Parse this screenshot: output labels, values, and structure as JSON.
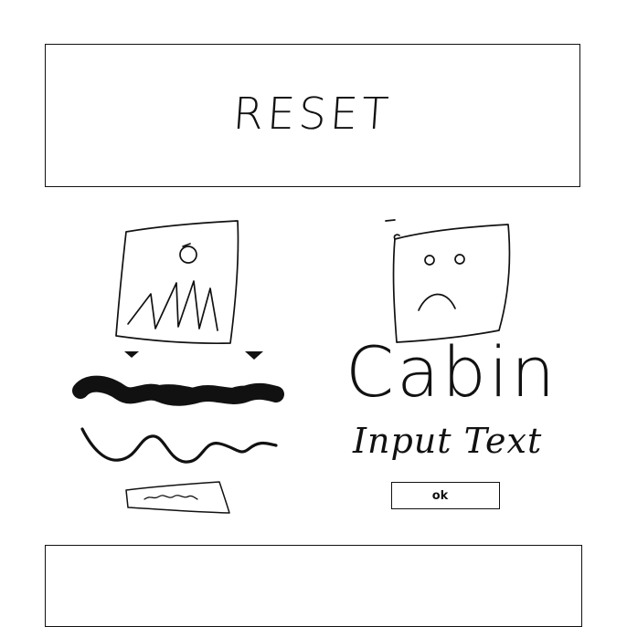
{
  "reset_button": {
    "label": "RESET"
  },
  "profile_card": {
    "icon": "sad-face-icon"
  },
  "image_card": {
    "icon": "image-placeholder-icon"
  },
  "title": {
    "text": "Cabin"
  },
  "input_label": {
    "text": "Input Text"
  },
  "ok_button": {
    "label": "ok"
  },
  "text_field": {
    "icon": "scribble-text-placeholder"
  },
  "heading_placeholder": {
    "icon": "heavy-scribble-heading-placeholder"
  },
  "paragraph_placeholder": {
    "icon": "wavy-line-text-placeholder"
  },
  "slider_handles": {
    "icon": "triangle-marker-icon"
  },
  "colors": {
    "ink": "#111111",
    "background": "#ffffff"
  }
}
